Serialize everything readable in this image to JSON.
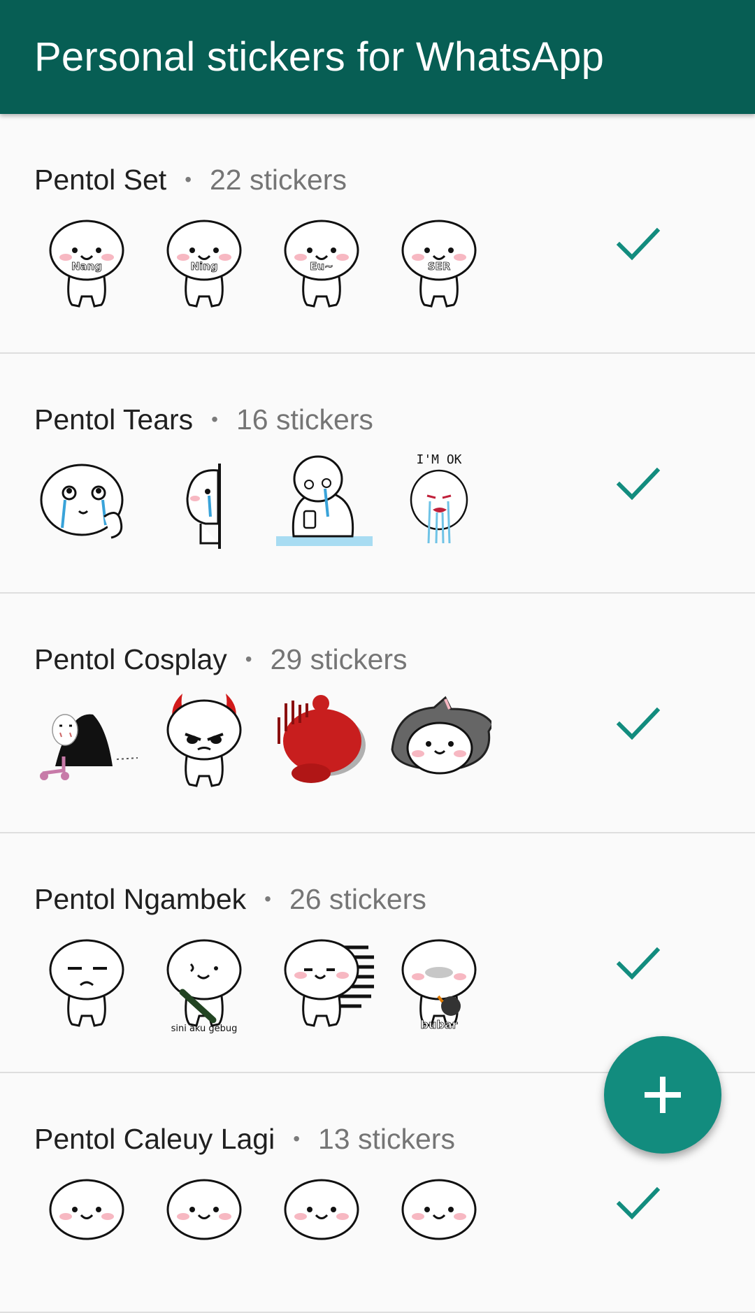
{
  "appbar": {
    "title": "Personal stickers for WhatsApp"
  },
  "colors": {
    "appbar": "#075e54",
    "accent": "#128c7e",
    "check": "#128c7e"
  },
  "packs": [
    {
      "name": "Pentol Set",
      "separator": "•",
      "count": "22 stickers",
      "added": true,
      "stickers": [
        {
          "icon": "pentol-standing-sticker",
          "caption": "Nang"
        },
        {
          "icon": "pentol-standing-sticker",
          "caption": "Ning"
        },
        {
          "icon": "pentol-standing-sticker",
          "caption": "Eu~"
        },
        {
          "icon": "pentol-standing-sticker",
          "caption": "SER"
        }
      ]
    },
    {
      "name": "Pentol Tears",
      "separator": "•",
      "count": "16 stickers",
      "added": true,
      "stickers": [
        {
          "icon": "pentol-crying-sticker",
          "caption": ""
        },
        {
          "icon": "pentol-peeking-crying-sticker",
          "caption": ""
        },
        {
          "icon": "pentol-crying-phone-sticker",
          "caption": ""
        },
        {
          "icon": "pentol-crying-ok-sticker",
          "caption": "I'M OK"
        }
      ]
    },
    {
      "name": "Pentol Cosplay",
      "separator": "•",
      "count": "29 stickers",
      "added": true,
      "stickers": [
        {
          "icon": "no-face-scooter-sticker",
          "caption": ""
        },
        {
          "icon": "devil-horns-sticker",
          "caption": ""
        },
        {
          "icon": "red-blob-sticker",
          "caption": ""
        },
        {
          "icon": "wolf-hood-sticker",
          "caption": ""
        }
      ]
    },
    {
      "name": "Pentol Ngambek",
      "separator": "•",
      "count": "26 stickers",
      "added": true,
      "stickers": [
        {
          "icon": "pentol-sulking-sticker",
          "caption": ""
        },
        {
          "icon": "pentol-bat-sticker",
          "caption": "sini aku gebug"
        },
        {
          "icon": "pentol-running-sticker",
          "caption": ""
        },
        {
          "icon": "pentol-bomb-sticker",
          "caption": "bubar"
        }
      ]
    },
    {
      "name": "Pentol Caleuy Lagi",
      "separator": "•",
      "count": "13 stickers",
      "added": true,
      "stickers": [
        {
          "icon": "pentol-sticker",
          "caption": ""
        },
        {
          "icon": "pentol-sticker",
          "caption": ""
        },
        {
          "icon": "pentol-sticker",
          "caption": ""
        },
        {
          "icon": "pentol-sticker",
          "caption": ""
        }
      ]
    }
  ],
  "fab": {
    "icon": "plus-icon"
  }
}
